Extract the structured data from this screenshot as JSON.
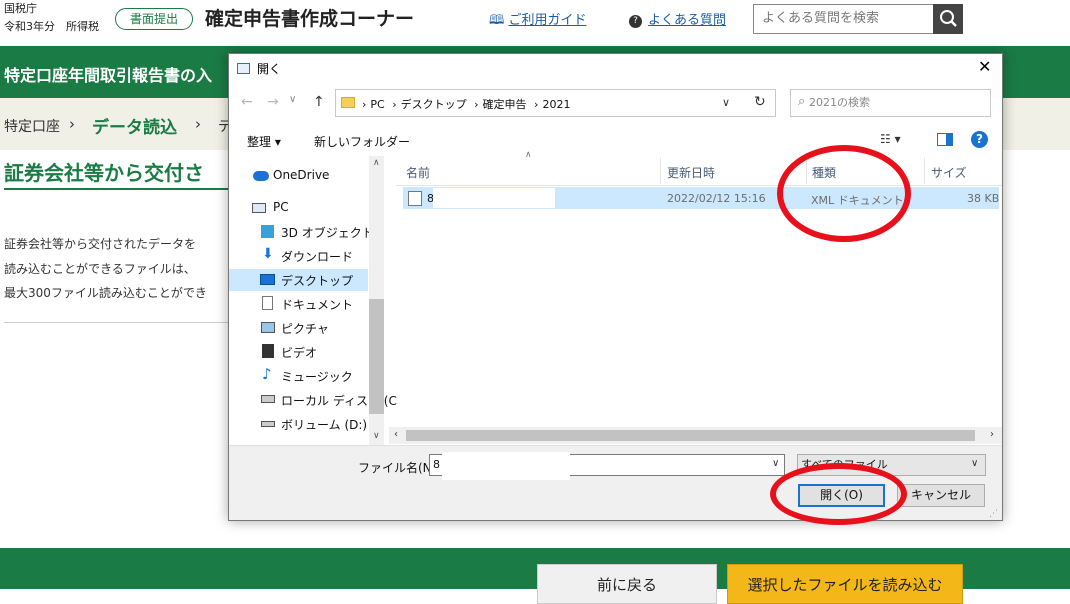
{
  "header": {
    "agency": "国税庁",
    "year": "令和3年分　所得税",
    "submit_button": "書面提出",
    "site_title": "確定申告書作成コーナー",
    "guide_link": "ご利用ガイド",
    "faq_link": "よくある質問",
    "search_placeholder": "よくある質問を検索"
  },
  "band_title": "特定口座年間取引報告書の入",
  "breadcrumb": {
    "items": [
      "特定口座",
      "データ読込",
      "デ"
    ]
  },
  "main": {
    "heading": "証券会社等から交付さ",
    "body_lines": [
      "証券会社等から交付されたデータを",
      "読み込むことができるファイルは、",
      "最大300ファイル読み込むことができ"
    ]
  },
  "footer_buttons": {
    "back": "前に戻る",
    "read": "選択したファイルを読み込む"
  },
  "dialog": {
    "title": "開く",
    "close": "✕",
    "address": [
      "PC",
      "デスクトップ",
      "確定申告",
      "2021"
    ],
    "search_placeholder": "2021の検索",
    "organize": "整理 ▾",
    "new_folder": "新しいフォルダー",
    "nav_items": [
      {
        "label": "OneDrive",
        "icon": "cloud-icon"
      },
      {
        "label": "PC",
        "icon": "computer-icon"
      },
      {
        "label": "3D オブジェクト",
        "icon": "cube-icon"
      },
      {
        "label": "ダウンロード",
        "icon": "download-icon"
      },
      {
        "label": "デスクトップ",
        "icon": "desktop-icon"
      },
      {
        "label": "ドキュメント",
        "icon": "document-icon"
      },
      {
        "label": "ピクチャ",
        "icon": "picture-icon"
      },
      {
        "label": "ビデオ",
        "icon": "video-icon"
      },
      {
        "label": "ミュージック",
        "icon": "music-icon"
      },
      {
        "label": "ローカル ディスク (C",
        "icon": "drive-icon"
      },
      {
        "label": "ボリューム (D:)",
        "icon": "drive-icon"
      }
    ],
    "selected_nav": "デスクトップ",
    "columns": [
      "名前",
      "更新日時",
      "種類",
      "サイズ"
    ],
    "files": [
      {
        "name": "8",
        "modified": "2022/02/12 15:16",
        "type": "XML ドキュメント",
        "size": "38 KB"
      }
    ],
    "filename_label": "ファイル名(N):",
    "filename_value": "8",
    "file_type": "すべてのファイル",
    "open_button": "開く(O)",
    "cancel_button": "キャンセル"
  },
  "colors": {
    "brand_green": "#1a7b45",
    "annotation_red": "#e8101a",
    "selection_blue": "#cce8ff",
    "accent_yellow": "#f3b717"
  }
}
